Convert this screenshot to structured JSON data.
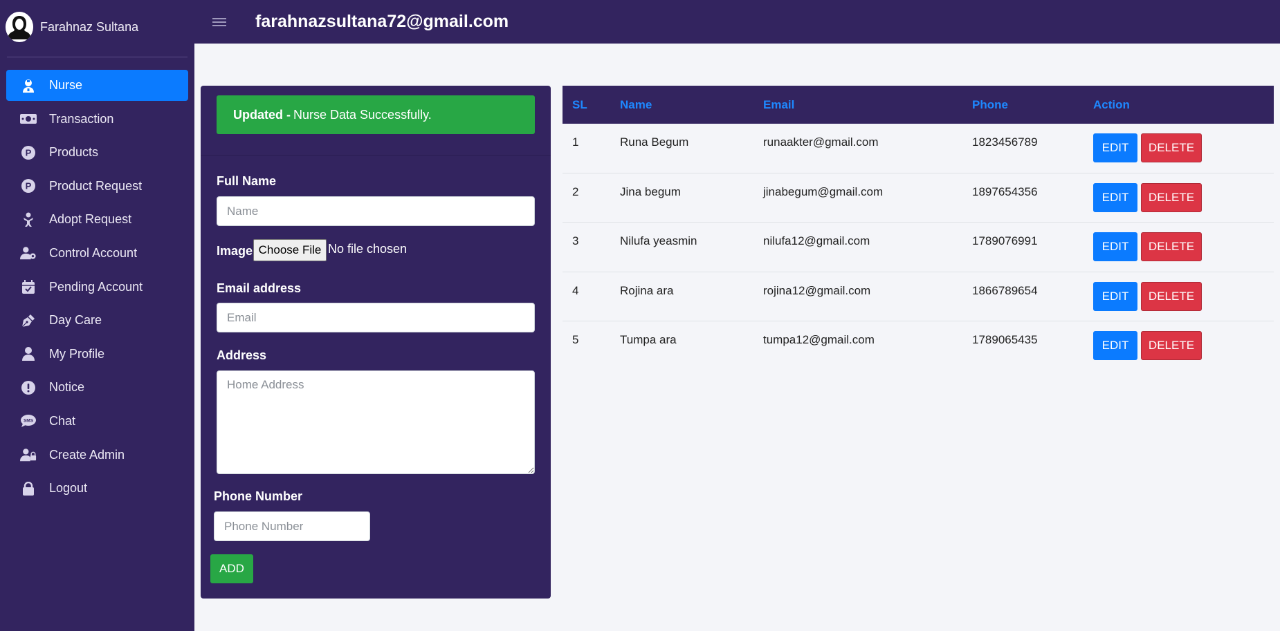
{
  "user": {
    "name": "Farahnaz Sultana",
    "email": "farahnazsultana72@gmail.com"
  },
  "sidebar": {
    "items": [
      {
        "label": "Nurse",
        "icon": "nurse-icon",
        "active": true
      },
      {
        "label": "Transaction",
        "icon": "money-icon"
      },
      {
        "label": "Products",
        "icon": "product-p-icon"
      },
      {
        "label": "Product Request",
        "icon": "product-p-icon"
      },
      {
        "label": "Adopt Request",
        "icon": "child-icon"
      },
      {
        "label": "Control Account",
        "icon": "user-gear-icon"
      },
      {
        "label": "Pending Account",
        "icon": "calendar-check-icon"
      },
      {
        "label": "Day Care",
        "icon": "pen-nib-icon"
      },
      {
        "label": "My Profile",
        "icon": "user-icon"
      },
      {
        "label": "Notice",
        "icon": "exclamation-circle-icon"
      },
      {
        "label": "Chat",
        "icon": "sms-icon"
      },
      {
        "label": "Create Admin",
        "icon": "user-lock-icon"
      },
      {
        "label": "Logout",
        "icon": "lock-icon"
      }
    ]
  },
  "form": {
    "alert_strong": "Updated -",
    "alert_text": "Nurse Data Successfully.",
    "full_name_label": "Full Name",
    "name_placeholder": "Name",
    "image_label": "Image",
    "choose_file": "Choose File",
    "no_file": "No file chosen",
    "email_label": "Email address",
    "email_placeholder": "Email",
    "address_label": "Address",
    "address_placeholder": "Home Address",
    "phone_label": "Phone Number",
    "phone_placeholder": "Phone Number",
    "add_button": "ADD"
  },
  "table": {
    "headers": {
      "sl": "SL",
      "name": "Name",
      "email": "Email",
      "phone": "Phone",
      "action": "Action"
    },
    "edit_label": "EDIT",
    "delete_label": "DELETE",
    "rows": [
      {
        "sl": "1",
        "name": "Runa Begum",
        "email": "runaakter@gmail.com",
        "phone": "1823456789"
      },
      {
        "sl": "2",
        "name": "Jina begum",
        "email": "jinabegum@gmail.com",
        "phone": "1897654356"
      },
      {
        "sl": "3",
        "name": "Nilufa yeasmin",
        "email": "nilufa12@gmail.com",
        "phone": "1789076991"
      },
      {
        "sl": "4",
        "name": "Rojina ara",
        "email": "rojina12@gmail.com",
        "phone": "1866789654"
      },
      {
        "sl": "5",
        "name": "Tumpa ara",
        "email": "tumpa12@gmail.com",
        "phone": "1789065435"
      }
    ]
  }
}
